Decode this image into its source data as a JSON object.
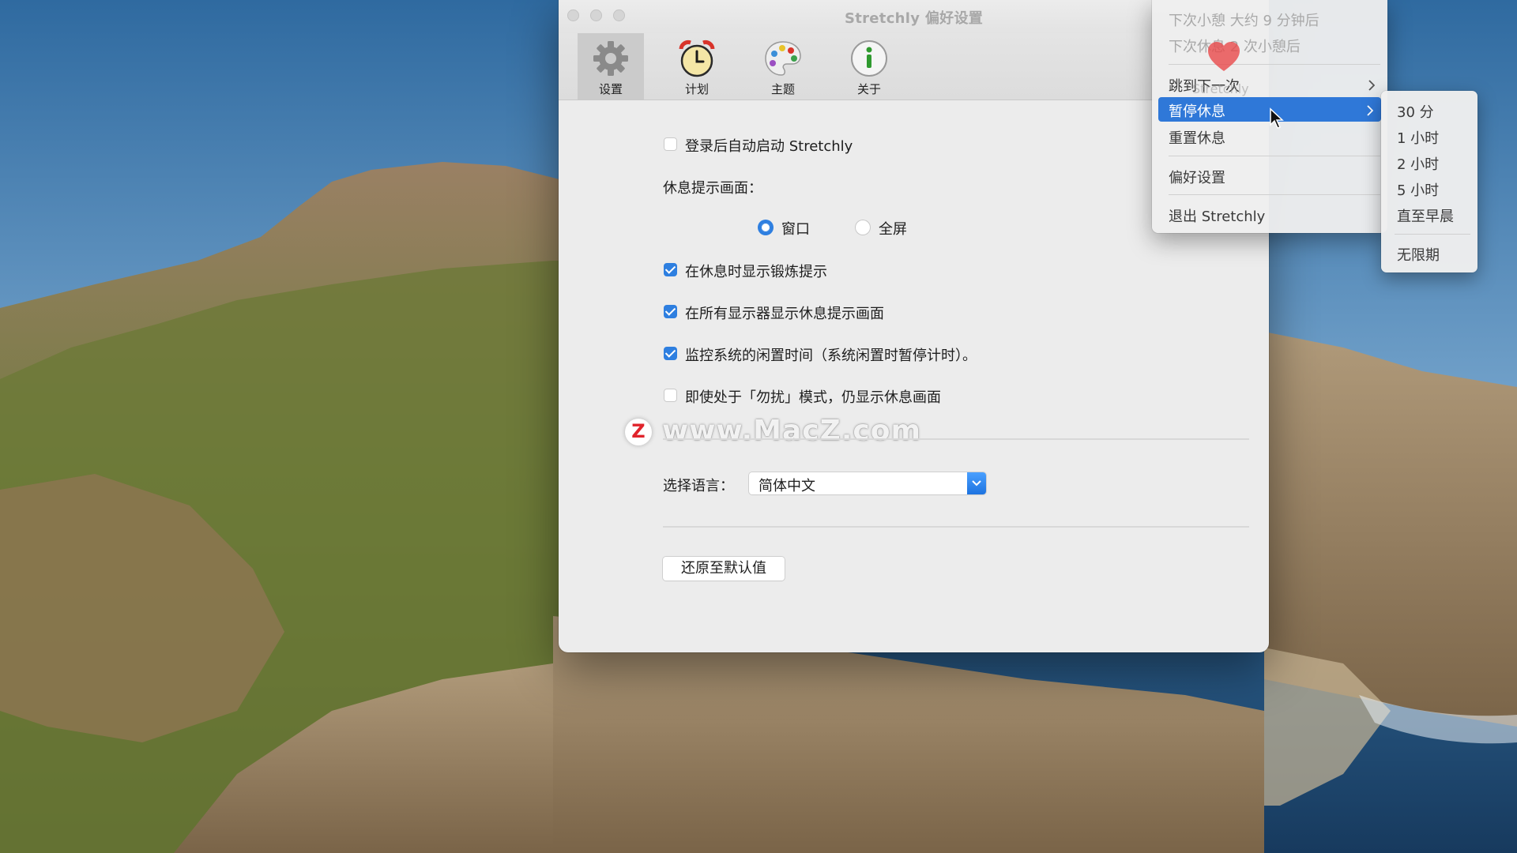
{
  "window": {
    "title": "Stretchly 偏好设置"
  },
  "toolbar": {
    "tabs": [
      {
        "label": "设置",
        "icon": "gear-icon",
        "active": true
      },
      {
        "label": "计划",
        "icon": "alarm-clock-icon",
        "active": false
      },
      {
        "label": "主题",
        "icon": "palette-icon",
        "active": false
      },
      {
        "label": "关于",
        "icon": "info-icon",
        "active": false
      }
    ]
  },
  "settings": {
    "autostart": {
      "label": "登录后自动启动 Stretchly",
      "checked": false
    },
    "break_screen_label": "休息提示画面：",
    "mode_window": {
      "label": "窗口",
      "selected": true
    },
    "mode_fullscreen": {
      "label": "全屏",
      "selected": false
    },
    "show_exercise": {
      "label": "在休息时显示锻炼提示",
      "checked": true
    },
    "all_displays": {
      "label": "在所有显示器显示休息提示画面",
      "checked": true
    },
    "monitor_idle": {
      "label": "监控系统的闲置时间（系统闲置时暂停计时）。",
      "checked": true
    },
    "dnd_show": {
      "label": "即使处于「勿扰」模式，仍显示休息画面",
      "checked": false
    },
    "language_label": "选择语言：",
    "language_value": "简体中文",
    "reset_button": "还原至默认值"
  },
  "watermark": {
    "logo_letter": "Z",
    "text": "www.MacZ.com"
  },
  "tray_menu": {
    "info_line1": "下次小憩 大约 9 分钟后",
    "info_line2": "下次休息 2 次小憩后",
    "skip": "跳到下一次",
    "ghost_text": "Stretchly",
    "pause": "暂停休息",
    "reset": "重置休息",
    "preferences": "偏好设置",
    "quit": "退出 Stretchly"
  },
  "pause_submenu": {
    "items": [
      "30 分",
      "1 小时",
      "2 小时",
      "5 小时",
      "直至早晨"
    ],
    "indefinite": "无限期"
  },
  "colors": {
    "accent": "#2f78d8",
    "checkbox": "#2e7fe0",
    "window_bg": "#ececec"
  }
}
